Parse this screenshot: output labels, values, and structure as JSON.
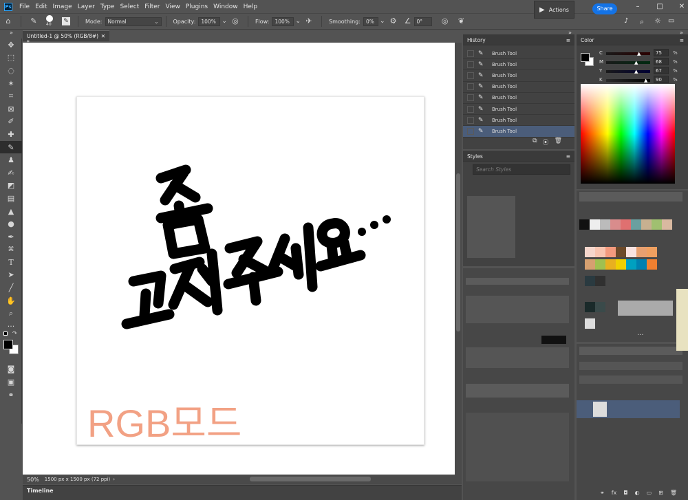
{
  "app": {
    "logo": "Ps"
  },
  "menu": [
    "File",
    "Edit",
    "Image",
    "Layer",
    "Type",
    "Select",
    "Filter",
    "View",
    "Plugins",
    "Window",
    "Help"
  ],
  "options": {
    "brush_size": "40",
    "mode_label": "Mode:",
    "mode_value": "Normal",
    "opacity_label": "Opacity:",
    "opacity_value": "100%",
    "flow_label": "Flow:",
    "flow_value": "100%",
    "smoothing_label": "Smoothing:",
    "smoothing_value": "0%",
    "angle_value": "0°"
  },
  "actions_panel": {
    "label": "Actions"
  },
  "share": {
    "label": "Share"
  },
  "document": {
    "tab_title": "Untitled-1 @ 50% (RGB/8#) *",
    "zoom": "50%",
    "doc_info": "1500 px x 1500 px (72 ppi)",
    "canvas_text": "RGB모드"
  },
  "timeline": {
    "label": "Timeline"
  },
  "history": {
    "title": "History",
    "items": [
      "Brush Tool",
      "Brush Tool",
      "Brush Tool",
      "Brush Tool",
      "Brush Tool",
      "Brush Tool",
      "Brush Tool",
      "Brush Tool"
    ],
    "selected_index": 7
  },
  "styles": {
    "title": "Styles",
    "search_placeholder": "Search Styles"
  },
  "color": {
    "title": "Color",
    "foreground": "#000000",
    "background": "#ffffff",
    "sliders": [
      {
        "letter": "C",
        "value": "75"
      },
      {
        "letter": "M",
        "value": "68"
      },
      {
        "letter": "Y",
        "value": "67"
      },
      {
        "letter": "K",
        "value": "90"
      }
    ],
    "percent": "%"
  },
  "colors": {
    "accent_blue": "#1473e6",
    "rgb_text": "#f2a184",
    "selected_row": "#4b5d7a"
  }
}
